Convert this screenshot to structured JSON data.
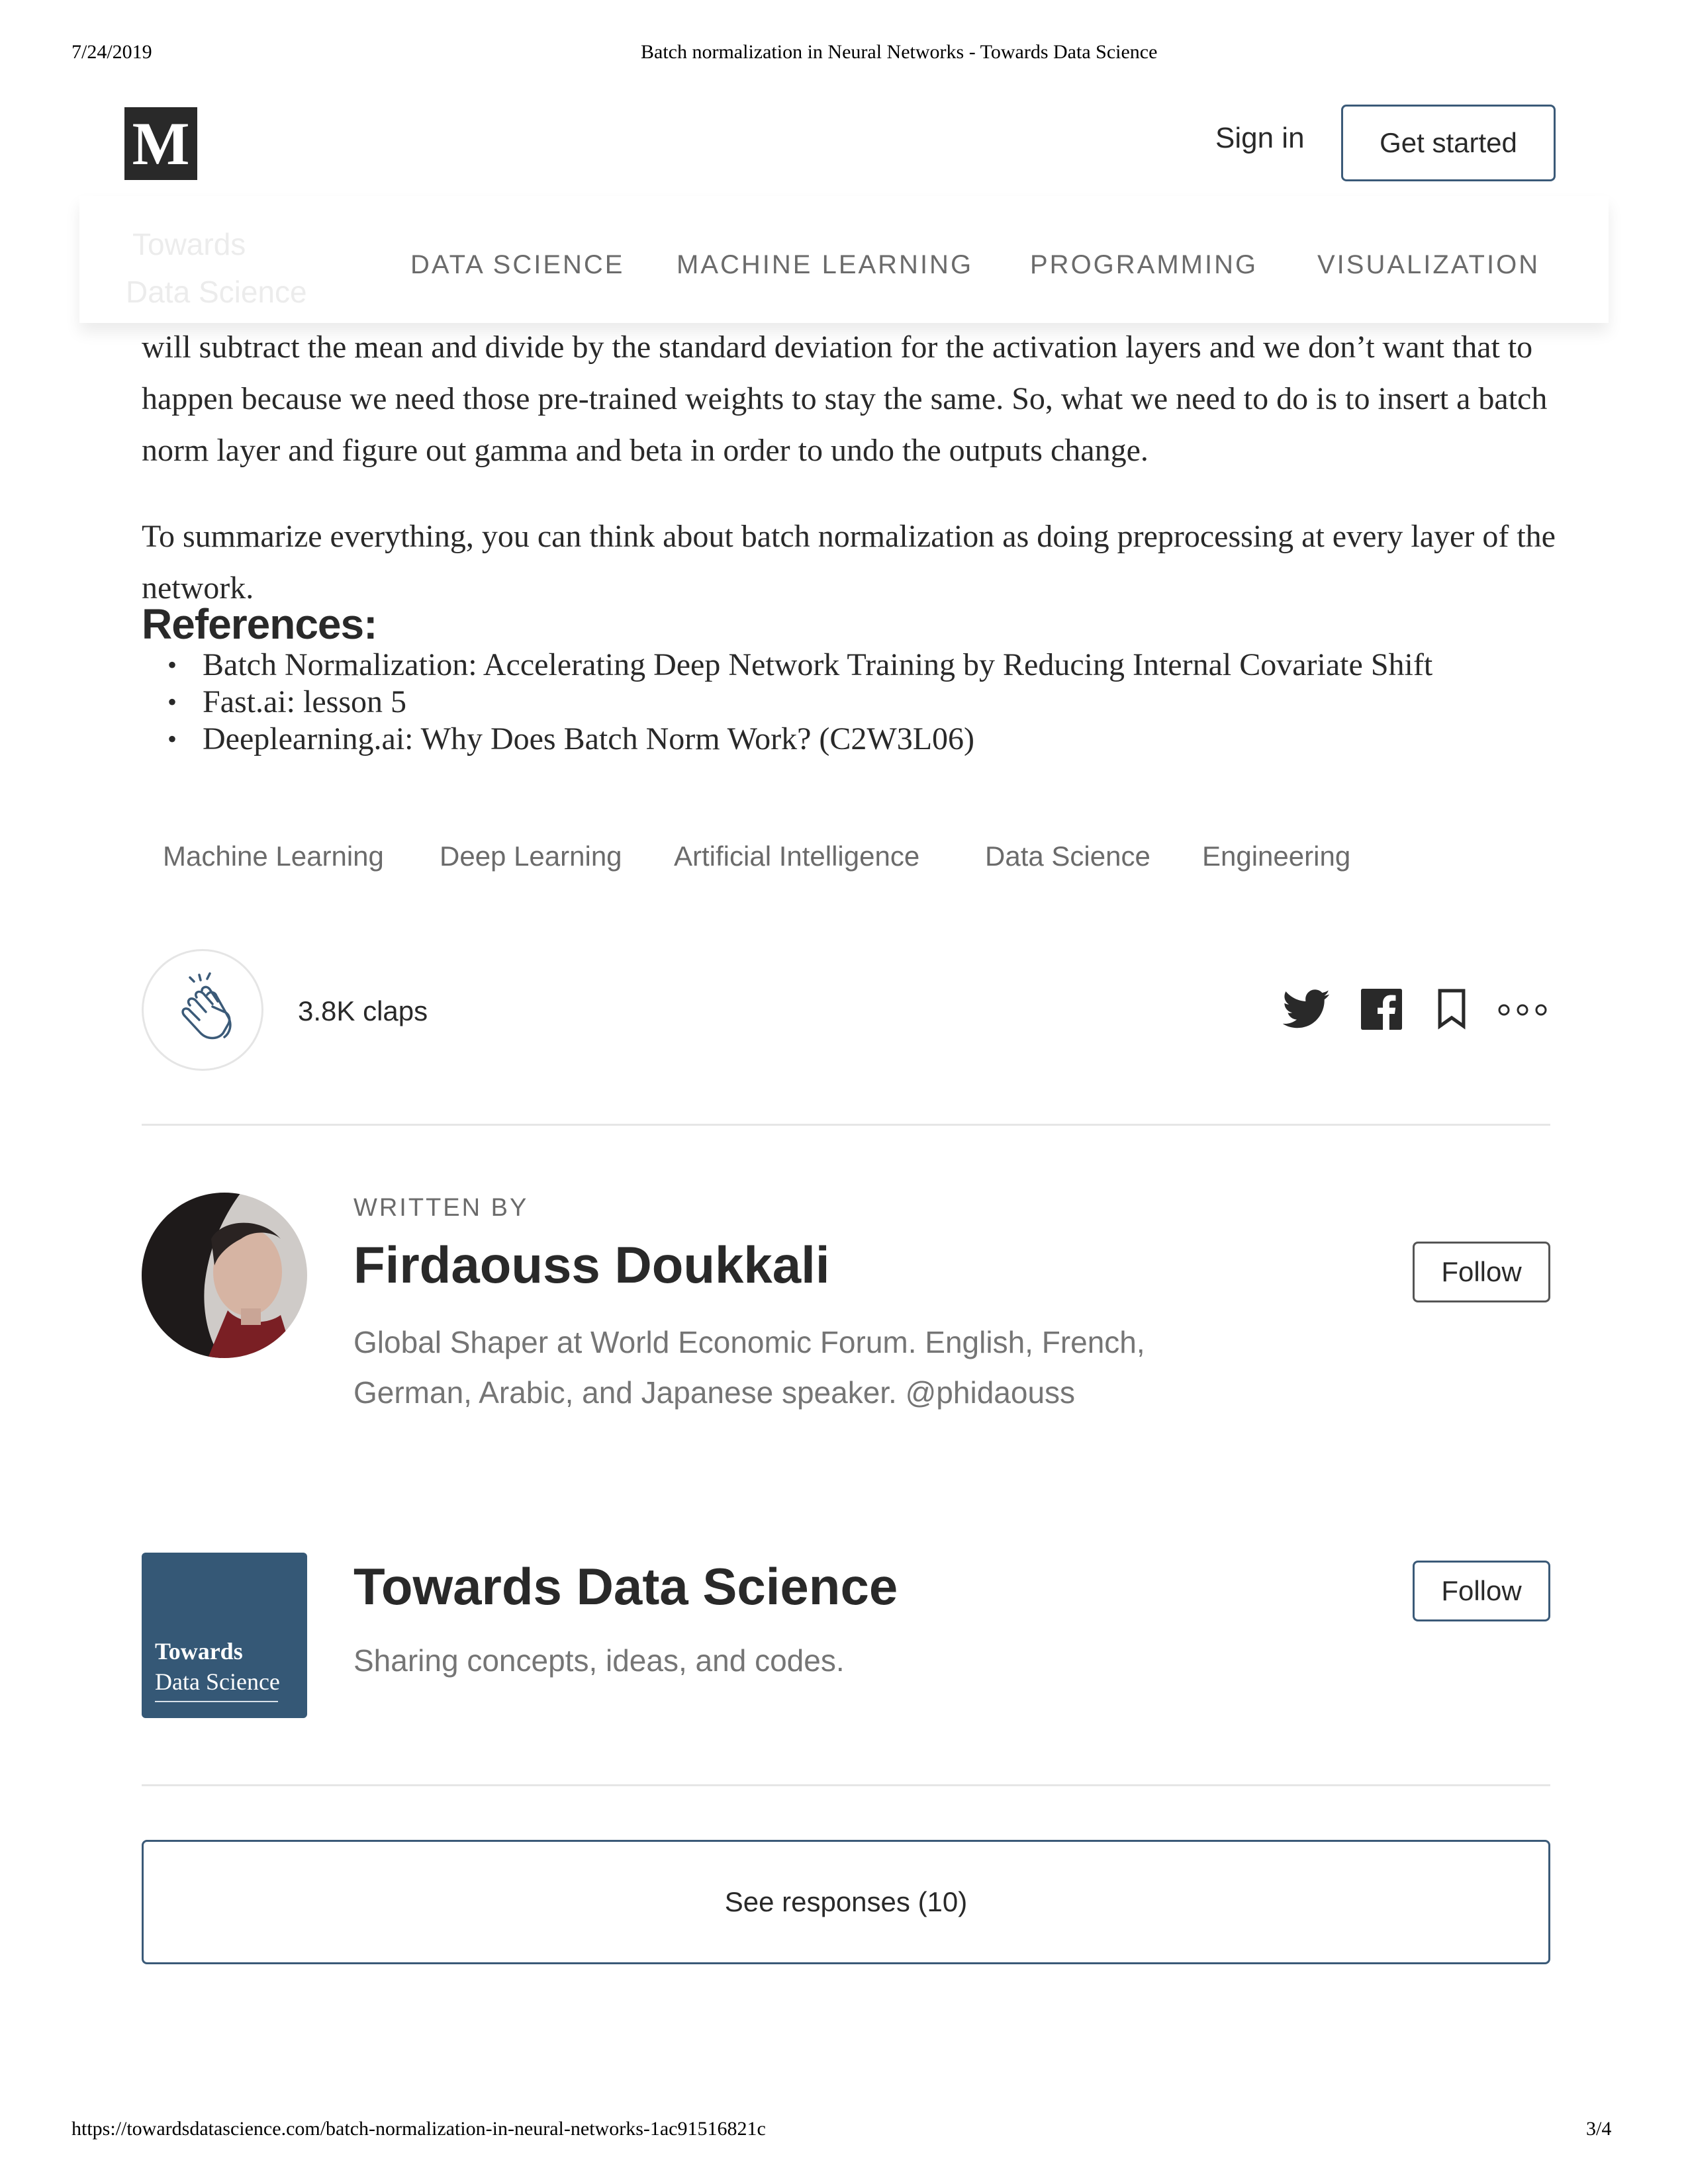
{
  "print_header": {
    "date": "7/24/2019",
    "title": "Batch normalization in Neural Networks - Towards Data Science"
  },
  "print_footer": {
    "url": "https://towardsdatascience.com/batch-normalization-in-neural-networks-1ac91516821c",
    "page": "3/4"
  },
  "topbar": {
    "logo_letter": "M",
    "sign_in": "Sign in",
    "get_started": "Get started"
  },
  "nav": {
    "ghost_line1": "Towards",
    "ghost_line2": "Data Science",
    "items": [
      "DATA SCIENCE",
      "MACHINE LEARNING",
      "PROGRAMMING",
      "VISUALIZATION"
    ]
  },
  "article": {
    "paragraph1": "will subtract the mean and divide by the standard deviation for the activation layers and we don’t want that to happen because we need those pre-trained weights to stay the same. So, what we need to do is to insert a batch norm layer and figure out gamma and beta in order to undo the outputs change.",
    "paragraph2": "To summarize everything, you can think about batch normalization as doing preprocessing at every layer of the network.",
    "references_heading": "References:",
    "references": [
      "Batch Normalization: Accelerating Deep Network Training by Reducing Internal Covariate Shift",
      "Fast.ai: lesson 5",
      "Deeplearning.ai: Why Does Batch Norm Work? (C2W3L06)"
    ]
  },
  "tags": [
    "Machine Learning",
    "Deep Learning",
    "Artificial Intelligence",
    "Data Science",
    "Engineering"
  ],
  "engagement": {
    "claps": "3.8K claps",
    "icons": [
      "clap-icon",
      "twitter-icon",
      "facebook-icon",
      "bookmark-icon",
      "more-icon"
    ]
  },
  "author": {
    "written_by": "WRITTEN BY",
    "name": "Firdaouss Doukkali",
    "bio": "Global Shaper at World Economic Forum. English, French, German, Arabic, and Japanese speaker. @phidaouss",
    "follow": "Follow"
  },
  "publication": {
    "logo_line1": "Towards",
    "logo_line2": "Data Science",
    "name": "Towards Data Science",
    "description": "Sharing concepts, ideas, and codes.",
    "follow": "Follow"
  },
  "responses": {
    "label": "See responses (10)"
  },
  "colors": {
    "accent": "#3b5a78",
    "publication_bg": "#355876",
    "text": "#292929",
    "muted": "#757575"
  }
}
